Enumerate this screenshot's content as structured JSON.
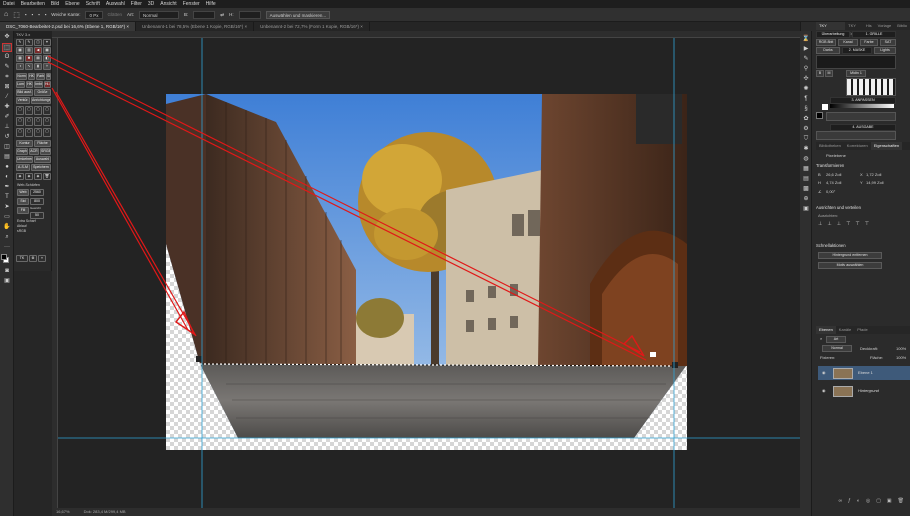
{
  "menu": [
    "Datei",
    "Bearbeiten",
    "Bild",
    "Ebene",
    "Schrift",
    "Auswahl",
    "Filter",
    "3D",
    "Ansicht",
    "Fenster",
    "Hilfe"
  ],
  "options": {
    "soft_edge_label": "Weiche Kante:",
    "soft_edge_value": "0 Px",
    "smooth_label": "Glätten",
    "style_label": "Art:",
    "style_value": "Normal",
    "width_label": "B:",
    "height_label": "H:",
    "select_mask_label": "Auswählen und maskieren..."
  },
  "tabs": [
    {
      "label": "DSC_7060-Bearbeitet-2.psd bei 16,6% (Ebene 1, RGB/16*) ×",
      "active": true
    },
    {
      "label": "Unbenannt-1 bei 78,5% (Ebene 1 Kopie, RGB/16*) ×",
      "active": false
    },
    {
      "label": "Unbenannt-2 bei 72,7% (Form 1 Kopie, RGB/16*) ×",
      "active": false
    }
  ],
  "tkv": {
    "title": "TKV 3.x",
    "buttons": [
      "Norm",
      "HK",
      "Farbe",
      "SM",
      "Lum",
      "HK",
      "Imbt",
      "Hi-K",
      "Bild ausf.",
      "Größe",
      "Verkür.",
      "Anrichtungsbild",
      "Kontur",
      "Fläche",
      "Graph",
      "ACR",
      "SRGB",
      "Umkehren",
      "Auswahl",
      "A-S-M",
      "Speichern"
    ],
    "web_label": "Web-Schärfen",
    "web_fields": [
      {
        "label": "Web",
        "value": "2560"
      },
      {
        "label": "Std",
        "value": "800"
      },
      {
        "label": "Fill",
        "value": "Gewicht"
      },
      {
        "label": "",
        "value": "50"
      }
    ],
    "checks": [
      "Extra Scharf",
      "Ablauf",
      "sRGB"
    ],
    "bottom_label": "TK"
  },
  "status": {
    "zoom": "16,67%",
    "doc": "Dok: 283,4 M/299,4 MB"
  },
  "right_panel": {
    "header": "TKY RapidMask",
    "tabs_top": [
      "TKY Ext",
      "His",
      "Vorlage",
      "Biblio"
    ],
    "workspace": "Überarbeitung",
    "grille_label": "1. GRILLE",
    "rows": [
      [
        "RGB 8bit",
        "Kanal",
        "Farbe",
        "SAT"
      ],
      [
        "Darks",
        "2. MASKE",
        "Lights"
      ],
      [
        "B",
        "M",
        "Midtn 1"
      ]
    ],
    "anpassen": "3. ANPASSEN",
    "ausgabe": "4. AUSGABE",
    "tabs_mid": [
      "Bibliotheken",
      "Korrekturen",
      "Eigenschaften"
    ],
    "pixel_layer": "Pixelebene",
    "transform_label": "Transformieren",
    "transform": {
      "w": "26,6 Zoll",
      "h": "4,74 Zoll",
      "x": "1,72 Zoll",
      "y": "14,99 Zoll",
      "angle": "0,00°"
    },
    "align_label": "Ausrichten und verteilen",
    "align_sub": "Ausrichten:",
    "quick_label": "Schnellaktionen",
    "quick_buttons": [
      "Hintergrund entfernen",
      "Motiv auswählen"
    ],
    "layers_tabs": [
      "Ebenen",
      "Kanäle",
      "Pfade"
    ],
    "kind_label": "Art",
    "blend": "Normal",
    "opacity_label": "Deckkraft:",
    "opacity": "100%",
    "lock_label": "Fixieren:",
    "fill_label": "Fläche:",
    "fill": "100%",
    "layers": [
      {
        "name": "Ebene 1",
        "selected": true
      },
      {
        "name": "Hintergrund",
        "selected": false
      }
    ]
  }
}
